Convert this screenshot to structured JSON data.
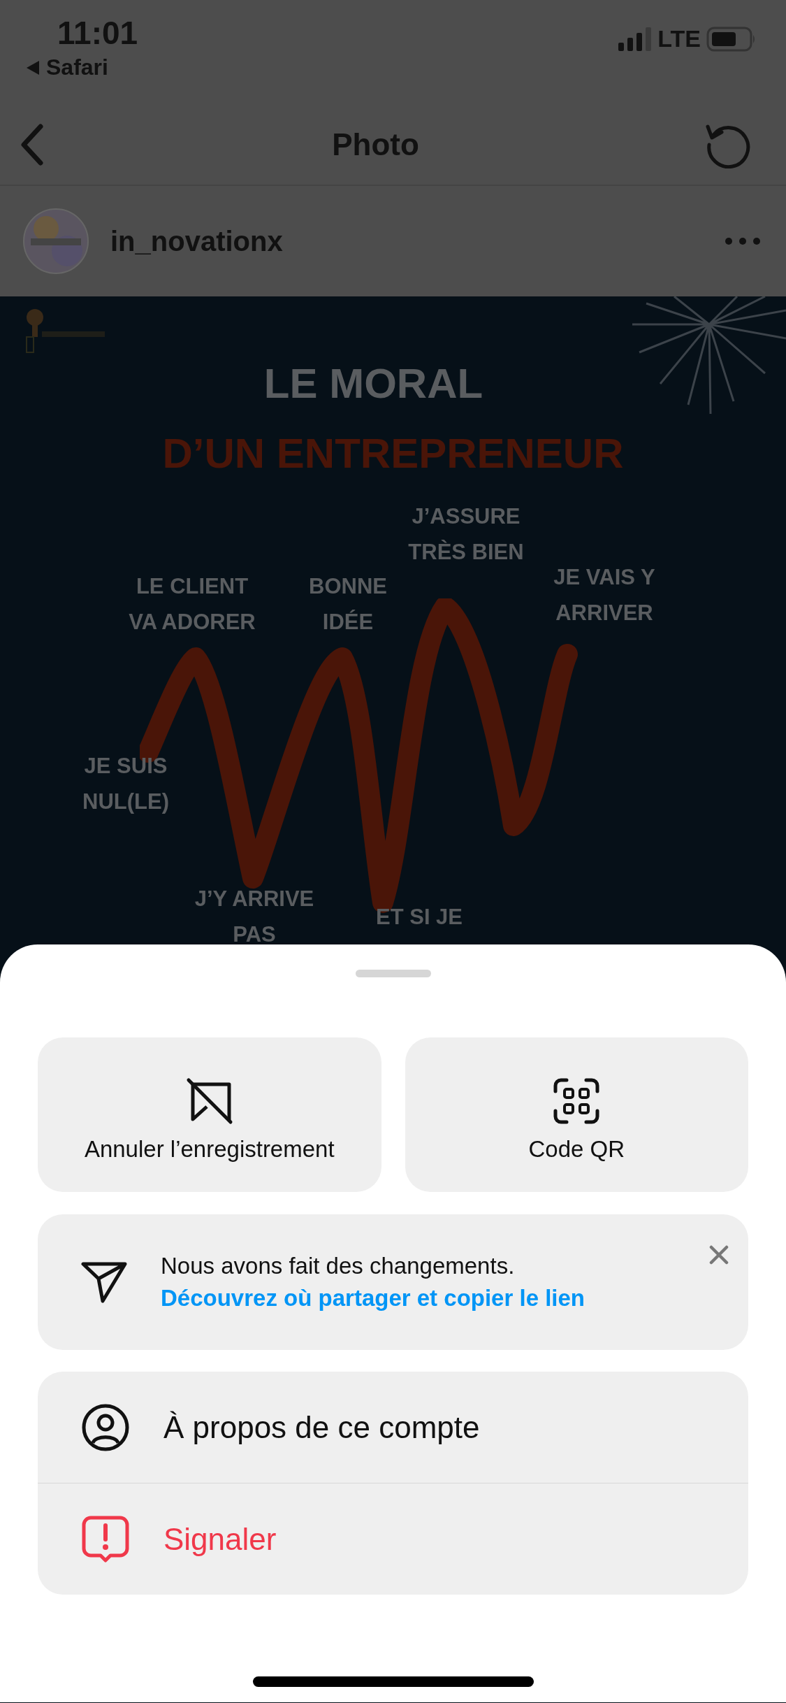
{
  "status_bar": {
    "time": "11:01",
    "back_app": "Safari",
    "network": "LTE"
  },
  "nav": {
    "title": "Photo"
  },
  "post": {
    "username": "in_novationx",
    "image": {
      "title": "LE MORAL",
      "subtitle": "D’UN ENTREPRENEUR",
      "labels": [
        {
          "lines": [
            "J’ASSURE",
            "TRÈS BIEN"
          ]
        },
        {
          "lines": [
            "LE CLIENT",
            "VA ADORER"
          ]
        },
        {
          "lines": [
            "BONNE",
            "IDÉE"
          ]
        },
        {
          "lines": [
            "JE VAIS Y",
            "ARRIVER"
          ]
        },
        {
          "lines": [
            "JE SUIS",
            "NUL(LE)"
          ]
        },
        {
          "lines": [
            "J’Y ARRIVE",
            "PAS"
          ]
        },
        {
          "lines": [
            "ET SI JE"
          ]
        }
      ]
    }
  },
  "sheet": {
    "actions": [
      {
        "kind": "unsave",
        "label": "Annuler l’enregistrement"
      },
      {
        "kind": "qr",
        "label": "Code QR"
      }
    ],
    "notice": {
      "text": "Nous avons fait des changements.",
      "link": "Découvrez où partager et copier le lien"
    },
    "menu": [
      {
        "kind": "about",
        "label": "À propos de ce compte",
        "danger": false
      },
      {
        "kind": "report",
        "label": "Signaler",
        "danger": true
      }
    ]
  }
}
